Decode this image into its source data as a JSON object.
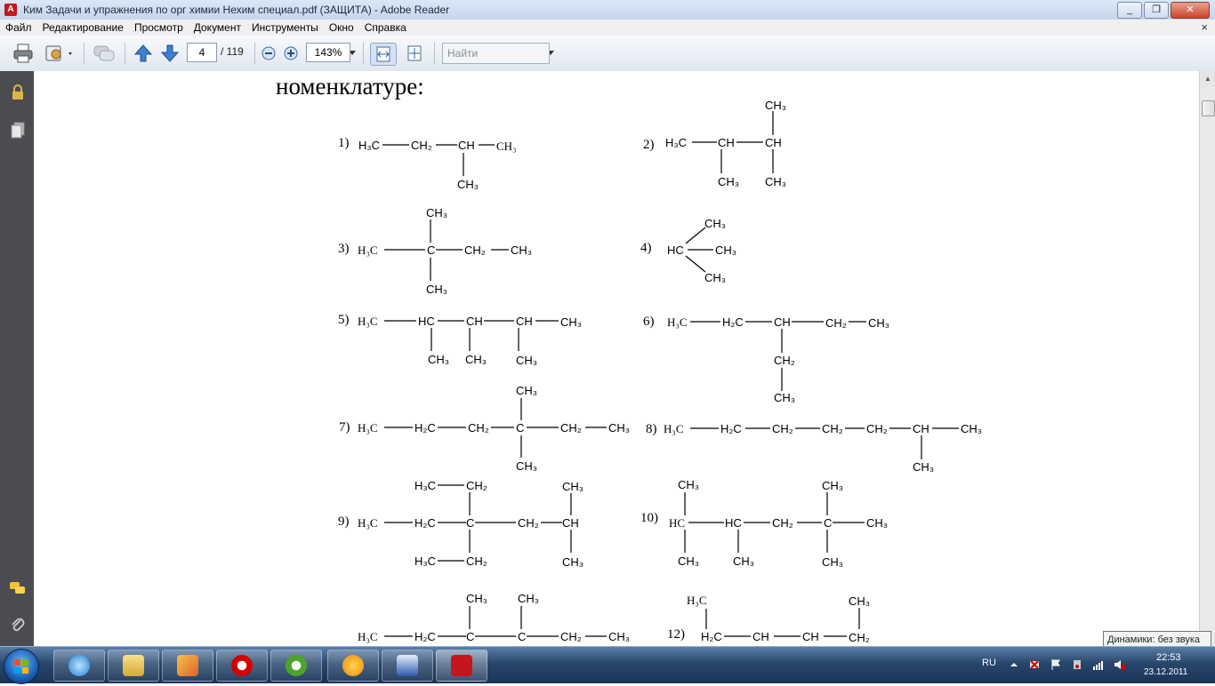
{
  "window": {
    "title": "Ким Задачи и упражнения по орг химии Нехим специал.pdf (ЗАЩИТА) - Adobe Reader",
    "controls": [
      "_",
      "❐",
      "✕"
    ]
  },
  "menu": {
    "items": [
      "Файл",
      "Редактирование",
      "Просмотр",
      "Документ",
      "Инструменты",
      "Окно",
      "Справка"
    ],
    "close_glyph": "×"
  },
  "toolbar": {
    "page_current": "4",
    "page_total": "/ 119",
    "zoom": "143%",
    "search_placeholder": "Найти"
  },
  "document": {
    "heading": "номенклатуре:",
    "problems": [
      "1)",
      "2)",
      "3)",
      "4)",
      "5)",
      "6)",
      "7)",
      "8)",
      "9)",
      "10)",
      "12)"
    ]
  },
  "taskbar": {
    "language": "RU",
    "time": "22:53",
    "date": "23.12.2011",
    "tooltip": "Динамики: без звука"
  },
  "colors": {
    "adobe_red": "#c4161c",
    "taskbar_blue": "#28466b",
    "panel_gray": "#4a4c50"
  }
}
